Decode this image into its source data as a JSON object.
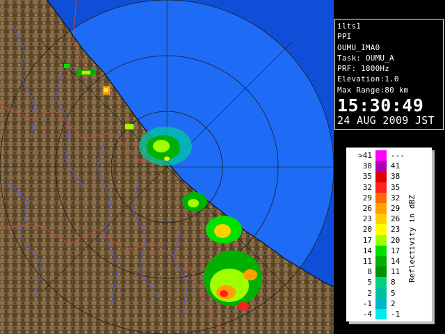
{
  "info": {
    "lines": [
      "ilts1",
      "PPI",
      "OUMU_IMA0",
      "Task: OUMU_A",
      "PRF: 1800Hz",
      "Elevation:1.0",
      "Max Range:80 km"
    ],
    "time": "15:30:49",
    "date": "24 AUG 2009 JST"
  },
  "legend": {
    "title": "Reflectivity in dBZ",
    "rows": [
      {
        "left": ">41",
        "right": "---",
        "color": "#ff00ff"
      },
      {
        "left": "38",
        "right": "41",
        "color": "#b000b0"
      },
      {
        "left": "35",
        "right": "38",
        "color": "#e00000"
      },
      {
        "left": "32",
        "right": "35",
        "color": "#ff2020"
      },
      {
        "left": "29",
        "right": "32",
        "color": "#ff6a00"
      },
      {
        "left": "26",
        "right": "29",
        "color": "#ffa000"
      },
      {
        "left": "23",
        "right": "26",
        "color": "#ffd000"
      },
      {
        "left": "20",
        "right": "23",
        "color": "#ffff00"
      },
      {
        "left": "17",
        "right": "20",
        "color": "#a0ff00"
      },
      {
        "left": "14",
        "right": "17",
        "color": "#00e000"
      },
      {
        "left": "11",
        "right": "14",
        "color": "#00b000"
      },
      {
        "left": "8",
        "right": "11",
        "color": "#009000"
      },
      {
        "left": "5",
        "right": "8",
        "color": "#00d080"
      },
      {
        "left": "2",
        "right": "5",
        "color": "#00c0a0"
      },
      {
        "left": "-1",
        "right": "2",
        "color": "#00b8c8"
      },
      {
        "left": "-4",
        "right": "-1",
        "color": "#00e8f0"
      }
    ]
  },
  "colors": {
    "ocean": "#1060e8",
    "range_ring_fill": "#2a80ff",
    "land": "#7a6040",
    "river": "#4858e0",
    "border": "#c04040"
  }
}
